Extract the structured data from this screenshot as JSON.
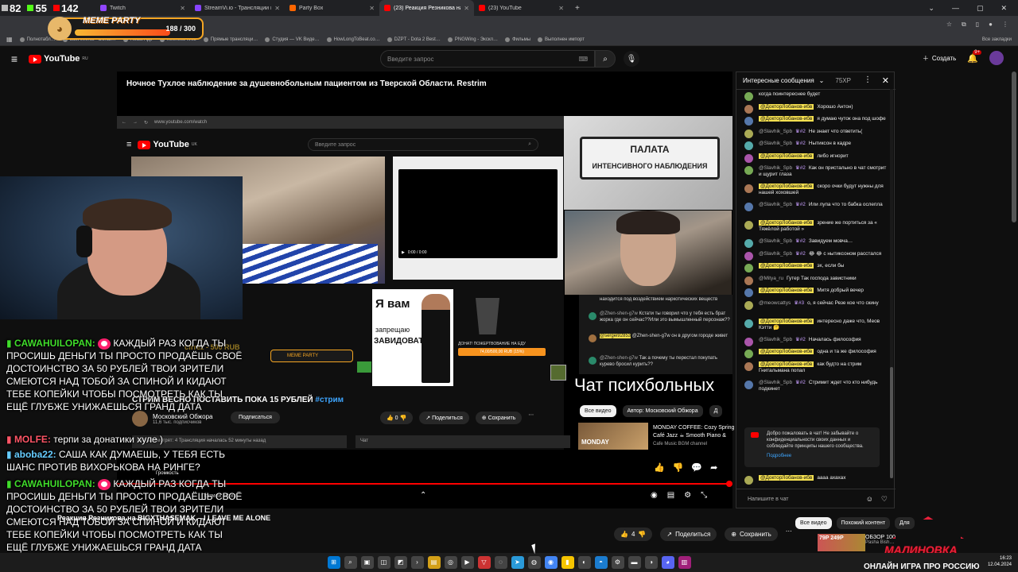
{
  "overlay_stats": {
    "s1": "82",
    "s2": "55",
    "s3": "142"
  },
  "tabs": [
    {
      "label": "Twitch",
      "color": "#9146ff",
      "active": false
    },
    {
      "label": "StreamVi.io - Трансляции в неск…",
      "color": "#8844ff",
      "active": false
    },
    {
      "label": "Party Box",
      "color": "#ff6600",
      "active": false
    },
    {
      "label": "(23) Реакция Резникова на BIC…",
      "color": "#ff0000",
      "active": true
    },
    {
      "label": "(23) YouTube",
      "color": "#ff0000",
      "active": false
    }
  ],
  "new_tab": "+",
  "bookmarks": [
    "Полнотабл…",
    "Last events · Donat…",
    "React App",
    "Keenetic Web",
    "Прямые трансляци…",
    "Студия — VK Виде…",
    "HowLongToBeat.co…",
    "DZPT - Dota 2 Best…",
    "PNGWing - Экскл…",
    "Фильмы",
    "Выполнен импорт"
  ],
  "bookmarks_right": "Все закладки",
  "meme_party": {
    "title": "MEME PARTY",
    "count": "188 / 300"
  },
  "youtube": {
    "logo": "YouTube",
    "region": "RU",
    "search_placeholder": "Введите запрос",
    "create": "Создать",
    "notif_count": "9+"
  },
  "video": {
    "title": "Ночное Тухлое наблюдение за душевнобольным пациентом из Тверской Области. Restrim",
    "nested_url": "www.youtube.com/watch",
    "nested_logo": "YouTube",
    "nested_region": "UK",
    "nested_search": "Введите запрос",
    "stream_title": "СТРИМ ВЕСНО ПОСТАВИТЬ ПОКА 15 РУБЛЕЙ",
    "stream_tag": "#стрим",
    "channel_name": "Московский Обжора",
    "channel_subs": "11,6 тыс. подписчиков",
    "subscribe": "Подписаться",
    "likes": "0",
    "share": "Поделиться",
    "save": "Сохранить",
    "live_info": "Сейчас смотрят: 4  Трансляция началась 52 минуты назад",
    "chat_label": "Чат",
    "palata_l1": "ПАЛАТА",
    "palata_l2": "ИНТЕНСИВНОГО НАБЛЮДЕНИЯ",
    "yavam_1": "Я вам",
    "yavam_2": "запрещаю",
    "yavam_3": "ЗАВИДОВАТЬ",
    "donate_label": "ДОНАТ! ПОЖЕРТВОВАНИЕ НА ЕДУ",
    "donate_bar": "74,00/500,00 RUB (15%)",
    "cfrez": "cfrrez - 500 RUB",
    "meme_small": "MEME PARTY",
    "chat_psy": "Чат психбольных",
    "nested_tab_all": "Все видео",
    "nested_tab_author": "Автор: Московский Обжора",
    "nested_tab_more": "Д",
    "rec_thumb": "MONDAY",
    "rec_title": "MONDAY COFFEE: Cozy Spring",
    "rec_title2": "Café Jazz ☕ Smooth Piano &",
    "rec_channel": "Cafe Music BGM channel",
    "gromkost": "Громкость",
    "efir": "Прямой эфир",
    "outer_title": "Реакция Резникова на BIGXTHASEMAK – I LEAVE ME ALONE",
    "outer_likes": "4",
    "outer_share": "Поделиться",
    "outer_save": "Сохранить",
    "outer_tab_all": "Все видео",
    "outer_tab_similar": "Похожий контент",
    "outer_tab_more": "Для",
    "outer_rec_thumb": "79P 249P",
    "outer_rec_title": "ОБЗОР 100",
    "outer_rec_channel": "Pasha Bish…"
  },
  "nested_chat": [
    {
      "name": "",
      "text": "находится под воздействием наркотических веществ",
      "hl": "",
      "color": "#666"
    },
    {
      "name": "@Zhen-shen-g7w",
      "text": "Кстати ты говорил что у тебя есть брат жорка где он сейчас??Или это вымышленный персонаж??",
      "hl": "",
      "color": "#2a8a6a"
    },
    {
      "name": "",
      "text": "@Zhen-shen-g7w он в другом городе живет",
      "hl": "@sergei92853",
      "color": "#a07040"
    },
    {
      "name": "@Zhen-shen-g7w",
      "text": "Так а почему ты перестал покупать курево бросил курить??",
      "hl": "",
      "color": "#2a8a6a"
    }
  ],
  "twitch_chat": [
    {
      "user": "CAWAHUILOPAN:",
      "msg": "КАЖДЫЙ РАЗ КОГДА ТЫ ПРОСИШЬ ДЕНЬГИ ТЫ ПРОСТО ПРОДАЁШЬ СВОЁ ДОСТОИНСТВО ЗА 50 РУБЛЕЙ ТВОИ ЗРИТЕЛИ СМЕЮТСЯ НАД ТОБОЙ ЗА СПИНОЙ И КИДАЮТ ТЕБЕ КОПЕЙКИ ЧТОБЫ ПОСМОТРЕТЬ КАК ТЫ ЕЩЁ ГЛУБЖЕ УНИЖАЕШЬСЯ ГРАНД ДАТА",
      "color": "#3fdc2a"
    },
    {
      "user": "MOLFE:",
      "msg": "терпи за донатики хуле )",
      "color": "#ff5566"
    },
    {
      "user": "aboba22:",
      "msg": "САША КАК ДУМАЕШЬ, У ТЕБЯ ЕСТЬ ШАНС ПРОТИВ ВИХОРЬКОВА НА РИНГЕ?",
      "color": "#66ccff"
    },
    {
      "user": "CAWAHUILOPAN:",
      "msg": "КАЖДЫЙ РАЗ КОГДА ТЫ ПРОСИШЬ ДЕНЬГИ ТЫ ПРОСТО ПРОДАЁШЬ СВОЁ ДОСТОИНСТВО ЗА 50 РУБЛЕЙ ТВОИ ЗРИТЕЛИ СМЕЮТСЯ НАД ТОБОЙ ЗА СПИНОЙ И КИДАЮТ ТЕБЕ КОПЕЙКИ ЧТОБЫ ПОСМОТРЕТЬ КАК ТЫ ЕЩЁ ГЛУБЖЕ УНИЖАЕШЬСЯ ГРАНД ДАТА",
      "color": "#3fdc2a"
    }
  ],
  "livechat": {
    "header": "Интересные сообщения",
    "xp": "75XP",
    "input_placeholder": "Напишите в чат",
    "welcome": "Добро пожаловать в чат! Не забывайте о конфиденциальности своих данных и соблюдайте принципы нашего сообщества.",
    "welcome_link": "Подробнее",
    "messages": [
      {
        "name": "",
        "badge": "",
        "hl": "",
        "text": "когда поинтереснее будет"
      },
      {
        "name": "",
        "badge": "",
        "hl": "@ДокторЛобанов-ибв",
        "text": "Хорошо Антон)"
      },
      {
        "name": "",
        "badge": "",
        "hl": "@ДокторЛобанов-ибв",
        "text": "я думаю чуток она под шофе"
      },
      {
        "name": "@Slavhik_Spb",
        "badge": "#2",
        "hl": "",
        "text": "Не знает что ответить("
      },
      {
        "name": "@Slavhik_Spb",
        "badge": "#2",
        "hl": "",
        "text": "Нытиксон в кадре"
      },
      {
        "name": "",
        "badge": "",
        "hl": "@ДокторЛобанов-ибв",
        "text": "либо игнорит"
      },
      {
        "name": "@Slavhik_Spb",
        "badge": "#2",
        "hl": "",
        "text": "Как он пристально в чат смотрит и щурит глаза"
      },
      {
        "name": "",
        "badge": "",
        "hl": "@ДокторЛобанов-ибв",
        "text": "скоро очки будут нужны для нашей хоховшей"
      },
      {
        "name": "@Slavhik_Spb",
        "badge": "#2",
        "hl": "",
        "text": "Или лупа что то бабка ослепла"
      },
      {
        "name": "",
        "badge": "",
        "hl": "@ДокторЛобанов-ибв",
        "text": "зрение же портиться за « Тяжёлой работой »"
      },
      {
        "name": "@Slavhik_Spb",
        "badge": "#2",
        "hl": "",
        "text": "Завидуем мовча…"
      },
      {
        "name": "@Slavhik_Spb",
        "badge": "#2",
        "hl": "",
        "text": "😂 😂 с нытиксоном расстался"
      },
      {
        "name": "",
        "badge": "",
        "hl": "@ДокторЛобанов-ибв",
        "text": "эх, если бы"
      },
      {
        "name": "@Mitya_ru",
        "badge": "",
        "hl": "",
        "text": "Гутер Так господа завистники"
      },
      {
        "name": "",
        "badge": "",
        "hl": "@ДокторЛобанов-ибв",
        "text": "Митя добрый вечер"
      },
      {
        "name": "@meowcattys",
        "badge": "#3",
        "hl": "",
        "text": "о, я сейчас Резе кое что скину"
      },
      {
        "name": "",
        "badge": "",
        "hl": "@ДокторЛобанов-ибв",
        "text": "интересно даже что, Меов Кэтти 🤔"
      },
      {
        "name": "@Slavhik_Spb",
        "badge": "#2",
        "hl": "",
        "text": "Началась философия"
      },
      {
        "name": "",
        "badge": "",
        "hl": "@ДокторЛобанов-ибв",
        "text": "одна и та же философия"
      },
      {
        "name": "",
        "badge": "",
        "hl": "@ДокторЛобанов-ибв",
        "text": "как будто на стрим Гнитальмана попал"
      },
      {
        "name": "@Slavhik_Spb",
        "badge": "#2",
        "hl": "",
        "text": "Стримит ждет что кто нибудь подкинет"
      },
      {
        "name": "",
        "badge": "",
        "hl": "@ДокторЛобанов-ибв",
        "text": "аааа ахахах"
      }
    ]
  },
  "malinovka": {
    "word": "МАЛИНОВКА",
    "sub": "ОНЛАЙН ИГРА ПРО РОССИЮ"
  },
  "taskbar": {
    "time": "16:23",
    "date": "12.04.2024"
  },
  "colors": {
    "accent": "#ff0000",
    "highlight": "#f5e050",
    "link": "#3ea6ff"
  }
}
